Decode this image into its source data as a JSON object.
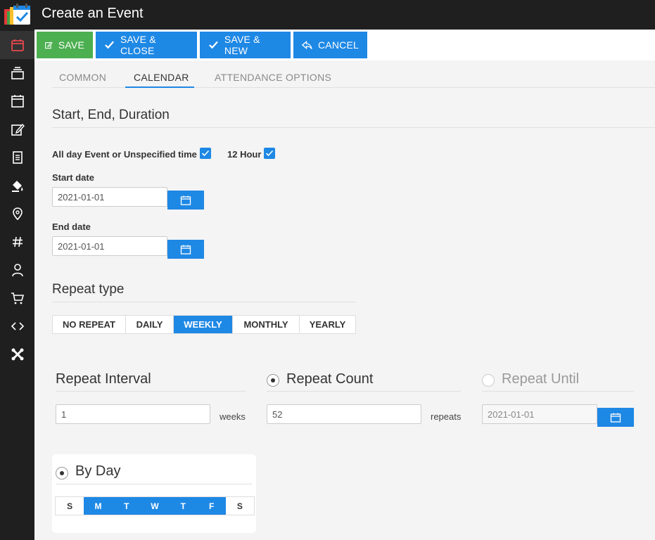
{
  "header": {
    "title": "Create an Event"
  },
  "sidebar": {
    "items": [
      {
        "icon": "calendar-icon",
        "active": true
      },
      {
        "icon": "layers-icon"
      },
      {
        "icon": "calendar-grid-icon"
      },
      {
        "icon": "edit-icon"
      },
      {
        "icon": "document-icon"
      },
      {
        "icon": "paint-bucket-icon"
      },
      {
        "icon": "location-pin-icon"
      },
      {
        "icon": "hashtag-icon"
      },
      {
        "icon": "user-icon"
      },
      {
        "icon": "cart-icon"
      },
      {
        "icon": "code-icon"
      },
      {
        "icon": "joomla-icon"
      }
    ]
  },
  "toolbar": {
    "save": "SAVE",
    "save_close": "SAVE & CLOSE",
    "save_new": "SAVE & NEW",
    "cancel": "CANCEL"
  },
  "tabs": [
    {
      "label": "COMMON"
    },
    {
      "label": "CALENDAR",
      "active": true
    },
    {
      "label": "ATTENDANCE OPTIONS"
    }
  ],
  "section": {
    "title": "Start, End, Duration"
  },
  "options": {
    "all_day_label": "All day Event or Unspecified time",
    "all_day_checked": true,
    "hour12_label": "12 Hour",
    "hour12_checked": true
  },
  "dates": {
    "start_label": "Start date",
    "start_value": "2021-01-01",
    "end_label": "End date",
    "end_value": "2021-01-01"
  },
  "repeat": {
    "title": "Repeat type",
    "options": [
      "NO REPEAT",
      "DAILY",
      "WEEKLY",
      "MONTHLY",
      "YEARLY"
    ],
    "selected": "WEEKLY",
    "interval_title": "Repeat Interval",
    "interval_value": "1",
    "interval_unit": "weeks",
    "count_title": "Repeat Count",
    "count_value": "52",
    "count_unit": "repeats",
    "count_selected": true,
    "until_title": "Repeat Until",
    "until_value": "2021-01-01",
    "until_selected": false
  },
  "byday": {
    "title": "By Day",
    "selected": true,
    "days": [
      "S",
      "M",
      "T",
      "W",
      "T",
      "F",
      "S"
    ],
    "active_days": [
      false,
      true,
      true,
      true,
      true,
      true,
      false
    ]
  },
  "colors": {
    "accent": "#1e88e5",
    "save_green": "#4caf50",
    "sidebar_bg": "#1f1f1f",
    "active_icon": "#e5484d"
  }
}
